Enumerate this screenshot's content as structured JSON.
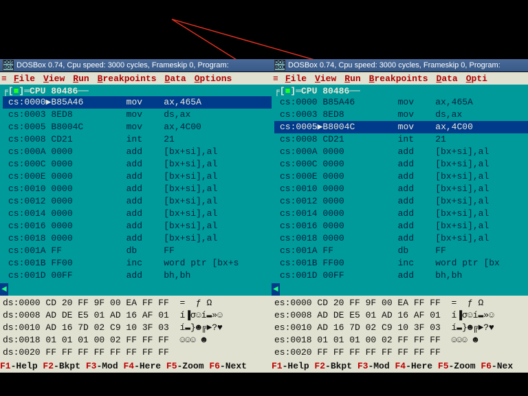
{
  "annotation_text": " ",
  "windows": [
    {
      "title": "DOSBox 0.74, Cpu speed:    3000 cycles, Frameskip  0, Program:",
      "menu_items": [
        "File",
        "View",
        "Run",
        "Breakpoints",
        "Data",
        "Options"
      ],
      "cpu_label": "CPU 80486",
      "highlight_index": 0,
      "disasm": [
        {
          "addr": "cs:0000",
          "mark": "▶",
          "bytes": "B85A46",
          "mn": "mov",
          "ops": "ax,465A"
        },
        {
          "addr": "cs:0003",
          "mark": " ",
          "bytes": "8ED8",
          "mn": "mov",
          "ops": "ds,ax"
        },
        {
          "addr": "cs:0005",
          "mark": " ",
          "bytes": "B8004C",
          "mn": "mov",
          "ops": "ax,4C00"
        },
        {
          "addr": "cs:0008",
          "mark": " ",
          "bytes": "CD21",
          "mn": "int",
          "ops": "21"
        },
        {
          "addr": "cs:000A",
          "mark": " ",
          "bytes": "0000",
          "mn": "add",
          "ops": "[bx+si],al"
        },
        {
          "addr": "cs:000C",
          "mark": " ",
          "bytes": "0000",
          "mn": "add",
          "ops": "[bx+si],al"
        },
        {
          "addr": "cs:000E",
          "mark": " ",
          "bytes": "0000",
          "mn": "add",
          "ops": "[bx+si],al"
        },
        {
          "addr": "cs:0010",
          "mark": " ",
          "bytes": "0000",
          "mn": "add",
          "ops": "[bx+si],al"
        },
        {
          "addr": "cs:0012",
          "mark": " ",
          "bytes": "0000",
          "mn": "add",
          "ops": "[bx+si],al"
        },
        {
          "addr": "cs:0014",
          "mark": " ",
          "bytes": "0000",
          "mn": "add",
          "ops": "[bx+si],al"
        },
        {
          "addr": "cs:0016",
          "mark": " ",
          "bytes": "0000",
          "mn": "add",
          "ops": "[bx+si],al"
        },
        {
          "addr": "cs:0018",
          "mark": " ",
          "bytes": "0000",
          "mn": "add",
          "ops": "[bx+si],al"
        },
        {
          "addr": "cs:001A",
          "mark": " ",
          "bytes": "FF",
          "mn": "db",
          "ops": "FF"
        },
        {
          "addr": "cs:001B",
          "mark": " ",
          "bytes": "FF00",
          "mn": "inc",
          "ops": "word ptr [bx+s"
        },
        {
          "addr": "cs:001D",
          "mark": " ",
          "bytes": "00FF",
          "mn": "add",
          "ops": "bh,bh"
        }
      ],
      "dump_seg": "ds",
      "dump": [
        {
          "addr": "0000",
          "hex": "CD 20 FF 9F 00 EA FF FF",
          "asc": "=  ƒ Ω"
        },
        {
          "addr": "0008",
          "hex": "AD DE E5 01 AD 16 AF 01",
          "asc": "í▐σ☺í▬»☺"
        },
        {
          "addr": "0010",
          "hex": "AD 16 7D 02 C9 10 3F 03",
          "asc": "í▬}☻╔►?♥"
        },
        {
          "addr": "0018",
          "hex": "01 01 01 00 02 FF FF FF",
          "asc": "☺☺☺ ☻"
        },
        {
          "addr": "0020",
          "hex": "FF FF FF FF FF FF FF FF",
          "asc": ""
        }
      ],
      "status": [
        [
          "F1",
          "-Help "
        ],
        [
          "F2",
          "-Bkpt "
        ],
        [
          "F3",
          "-Mod "
        ],
        [
          "F4",
          "-Here "
        ],
        [
          "F5",
          "-Zoom "
        ],
        [
          "F6",
          "-Next"
        ]
      ]
    },
    {
      "title": "DOSBox 0.74, Cpu speed:    3000 cycles, Frameskip  0, Program:",
      "menu_items": [
        "File",
        "View",
        "Run",
        "Breakpoints",
        "Data",
        "Opti"
      ],
      "cpu_label": "CPU 80486",
      "highlight_index": 2,
      "disasm": [
        {
          "addr": "cs:0000",
          "mark": " ",
          "bytes": "B85A46",
          "mn": "mov",
          "ops": "ax,465A"
        },
        {
          "addr": "cs:0003",
          "mark": " ",
          "bytes": "8ED8",
          "mn": "mov",
          "ops": "ds,ax"
        },
        {
          "addr": "cs:0005",
          "mark": "▶",
          "bytes": "B8004C",
          "mn": "mov",
          "ops": "ax,4C00"
        },
        {
          "addr": "cs:0008",
          "mark": " ",
          "bytes": "CD21",
          "mn": "int",
          "ops": "21"
        },
        {
          "addr": "cs:000A",
          "mark": " ",
          "bytes": "0000",
          "mn": "add",
          "ops": "[bx+si],al"
        },
        {
          "addr": "cs:000C",
          "mark": " ",
          "bytes": "0000",
          "mn": "add",
          "ops": "[bx+si],al"
        },
        {
          "addr": "cs:000E",
          "mark": " ",
          "bytes": "0000",
          "mn": "add",
          "ops": "[bx+si],al"
        },
        {
          "addr": "cs:0010",
          "mark": " ",
          "bytes": "0000",
          "mn": "add",
          "ops": "[bx+si],al"
        },
        {
          "addr": "cs:0012",
          "mark": " ",
          "bytes": "0000",
          "mn": "add",
          "ops": "[bx+si],al"
        },
        {
          "addr": "cs:0014",
          "mark": " ",
          "bytes": "0000",
          "mn": "add",
          "ops": "[bx+si],al"
        },
        {
          "addr": "cs:0016",
          "mark": " ",
          "bytes": "0000",
          "mn": "add",
          "ops": "[bx+si],al"
        },
        {
          "addr": "cs:0018",
          "mark": " ",
          "bytes": "0000",
          "mn": "add",
          "ops": "[bx+si],al"
        },
        {
          "addr": "cs:001A",
          "mark": " ",
          "bytes": "FF",
          "mn": "db",
          "ops": "FF"
        },
        {
          "addr": "cs:001B",
          "mark": " ",
          "bytes": "FF00",
          "mn": "inc",
          "ops": "word ptr [bx"
        },
        {
          "addr": "cs:001D",
          "mark": " ",
          "bytes": "00FF",
          "mn": "add",
          "ops": "bh,bh"
        }
      ],
      "dump_seg": "es",
      "dump": [
        {
          "addr": "0000",
          "hex": "CD 20 FF 9F 00 EA FF FF",
          "asc": "=  ƒ Ω"
        },
        {
          "addr": "0008",
          "hex": "AD DE E5 01 AD 16 AF 01",
          "asc": "í▐σ☺í▬»☺"
        },
        {
          "addr": "0010",
          "hex": "AD 16 7D 02 C9 10 3F 03",
          "asc": "í▬}☻╔►?♥"
        },
        {
          "addr": "0018",
          "hex": "01 01 01 00 02 FF FF FF",
          "asc": "☺☺☺ ☻"
        },
        {
          "addr": "0020",
          "hex": "FF FF FF FF FF FF FF FF",
          "asc": ""
        }
      ],
      "status": [
        [
          "F1",
          "-Help "
        ],
        [
          "F2",
          "-Bkpt "
        ],
        [
          "F3",
          "-Mod "
        ],
        [
          "F4",
          "-Here "
        ],
        [
          "F5",
          "-Zoom "
        ],
        [
          "F6",
          "-Nex"
        ]
      ]
    }
  ]
}
